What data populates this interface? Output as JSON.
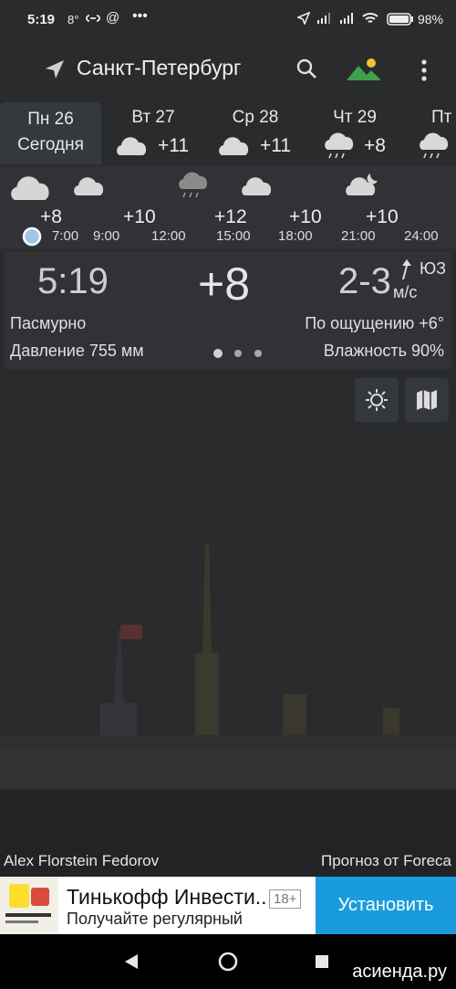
{
  "status_bar": {
    "time": "5:19",
    "temp": "8°",
    "battery": "98%"
  },
  "toolbar": {
    "city": "Санкт-Петербург",
    "icons": [
      "location-arrow-icon",
      "search-icon",
      "landscape-icon",
      "more-vert-icon"
    ]
  },
  "days": [
    {
      "name": "Пн 26",
      "sub": "Сегодня",
      "selected": true
    },
    {
      "name": "Вт 27",
      "temp": "+11",
      "icon": "cloud-icon"
    },
    {
      "name": "Ср 28",
      "temp": "+11",
      "icon": "cloud-icon"
    },
    {
      "name": "Чт 29",
      "temp": "+8",
      "icon": "rain-cloud-icon"
    },
    {
      "name": "Пт",
      "icon": "rain-cloud-icon"
    }
  ],
  "hourly": {
    "temps": [
      "+8",
      "+10",
      "+12",
      "+10",
      "+10"
    ],
    "hours": [
      "7:00",
      "9:00",
      "12:00",
      "15:00",
      "18:00",
      "21:00",
      "24:00"
    ]
  },
  "current": {
    "time": "5:19",
    "temp": "+8",
    "wind_speed": "2-3",
    "wind_dir": "ЮЗ",
    "wind_unit": "м/с",
    "condition": "Пасмурно",
    "feels_like": "По ощущению +6°",
    "pressure": "Давление 755 мм",
    "humidity": "Влажность 90%"
  },
  "credits": {
    "photo": "Alex Florstein Fedorov",
    "forecast": "Прогноз от Foreca"
  },
  "ad": {
    "title": "Тинькофф Инвести..",
    "description": "Получайте регулярный",
    "age": "18+",
    "button": "Установить"
  },
  "watermark": "асиенда.ру",
  "colors": {
    "background": "#2b2c2e",
    "panel": "#303236",
    "ad_button": "#1a9bdd",
    "landscape_green": "#3fa14a",
    "sun_yellow": "#f2c12e"
  }
}
